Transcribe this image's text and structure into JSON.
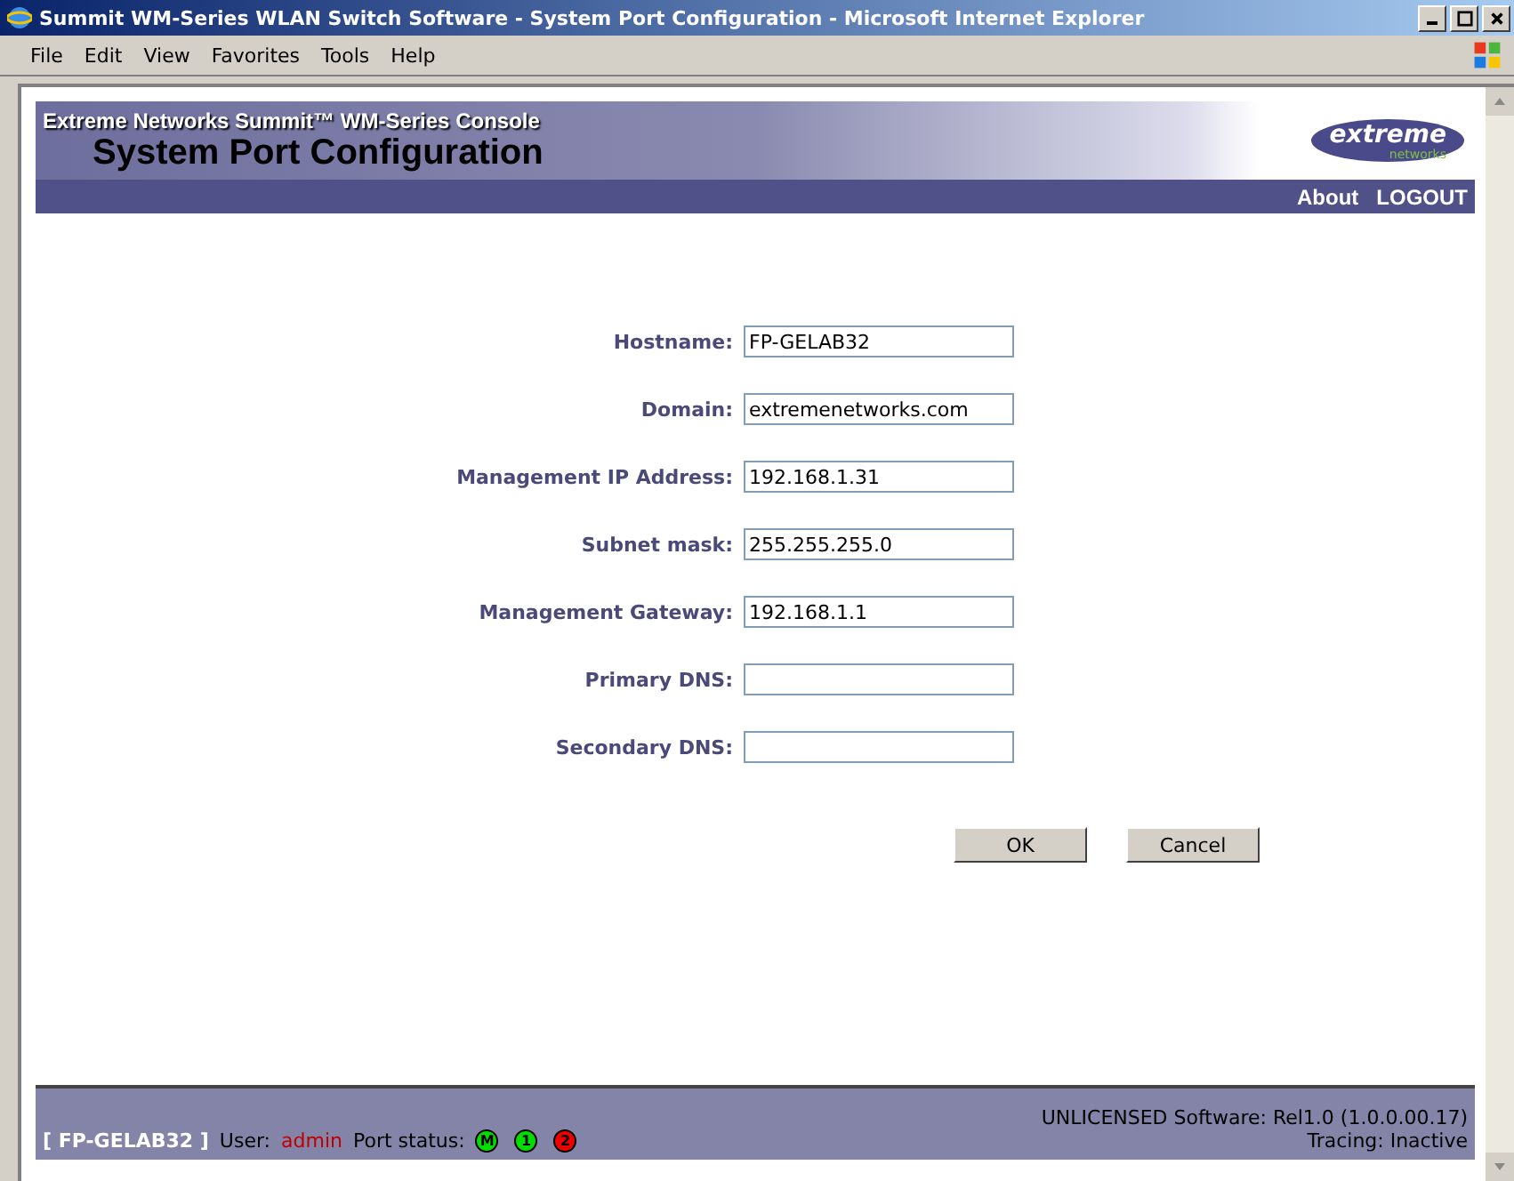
{
  "window": {
    "title": "Summit WM-Series WLAN Switch Software - System Port Configuration - Microsoft Internet Explorer"
  },
  "menu": [
    "File",
    "Edit",
    "View",
    "Favorites",
    "Tools",
    "Help"
  ],
  "header": {
    "subtitle": "Extreme Networks Summit™ WM-Series Console",
    "title": "System Port Configuration",
    "logo_word": "extreme",
    "logo_sub": "networks"
  },
  "nav_links": [
    "About",
    "LOGOUT"
  ],
  "fields": [
    {
      "label": "Hostname:",
      "value": "FP-GELAB32"
    },
    {
      "label": "Domain:",
      "value": "extremenetworks.com"
    },
    {
      "label": "Management IP Address:",
      "value": "192.168.1.31"
    },
    {
      "label": "Subnet mask:",
      "value": "255.255.255.0"
    },
    {
      "label": "Management Gateway:",
      "value": "192.168.1.1"
    },
    {
      "label": "Primary DNS:"
    },
    {
      "label": "Secondary DNS:"
    }
  ],
  "buttons": [
    "OK",
    "Cancel"
  ],
  "status_bar": {
    "host": "[ FP-GELAB32 ]",
    "user_label": "User:",
    "user": "admin",
    "port_label": "Port status:",
    "ports": [
      {
        "label": "M",
        "color": "#00dd00"
      },
      {
        "label": "1",
        "color": "#00dd00"
      },
      {
        "label": "2",
        "color": "#ee0000"
      }
    ],
    "license": "UNLICENSED Software: Rel1.0 (1.0.0.00.17)",
    "tracing": "Tracing: Inactive"
  }
}
